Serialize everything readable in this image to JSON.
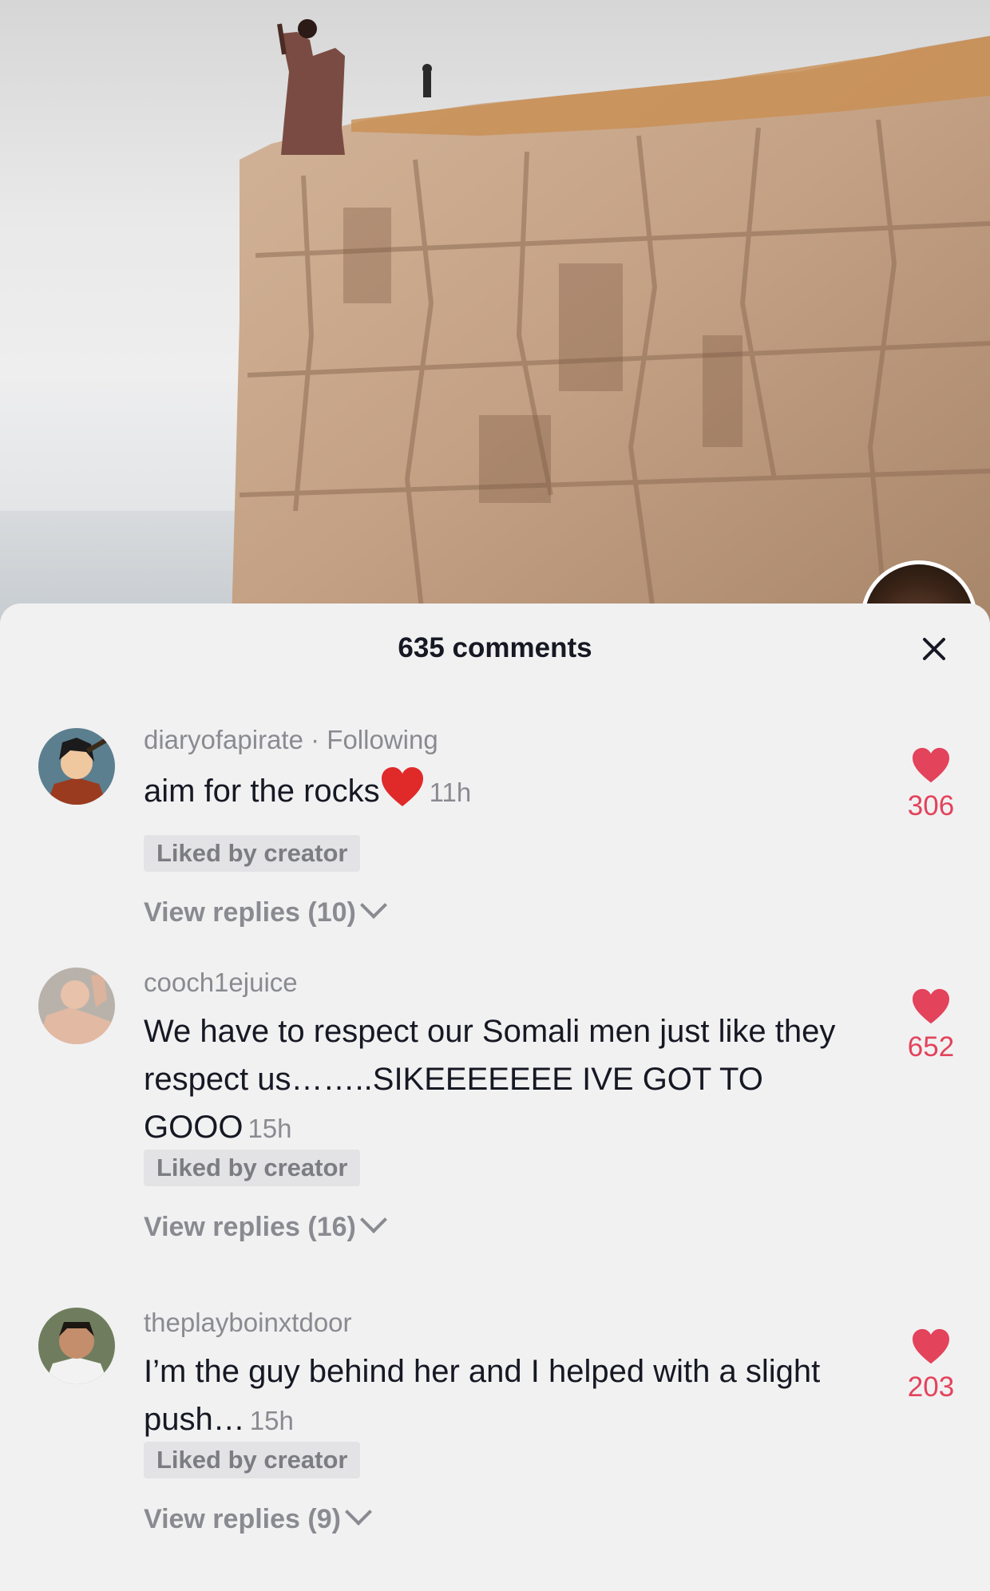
{
  "header": {
    "title": "635 comments",
    "close_icon": "close-icon"
  },
  "colors": {
    "like_red": "#e3435b",
    "sheet_bg": "#f1f1f2",
    "muted_text": "#8a8b91",
    "primary_text": "#161823"
  },
  "comments": [
    {
      "username": "diaryofapirate",
      "separator": " · ",
      "relation": "Following",
      "text": "aim for the rocks",
      "emoji": "red-heart-emoji",
      "time": "11h",
      "badge": "Liked by creator",
      "replies": "View replies (10)",
      "likes": "306"
    },
    {
      "username": "cooch1ejuice",
      "text": "We have to respect our Somali men just like they respect us……..SIKEEEEEEE IVE GOT TO GOOO",
      "time": "15h",
      "badge": "Liked by creator",
      "replies": "View replies (16)",
      "likes": "652"
    },
    {
      "username": "theplayboinxtdoor",
      "text": "I’m the guy behind her and I helped with a slight push…",
      "time": "15h",
      "badge": "Liked by creator",
      "replies": "View replies (9)",
      "likes": "203"
    }
  ]
}
